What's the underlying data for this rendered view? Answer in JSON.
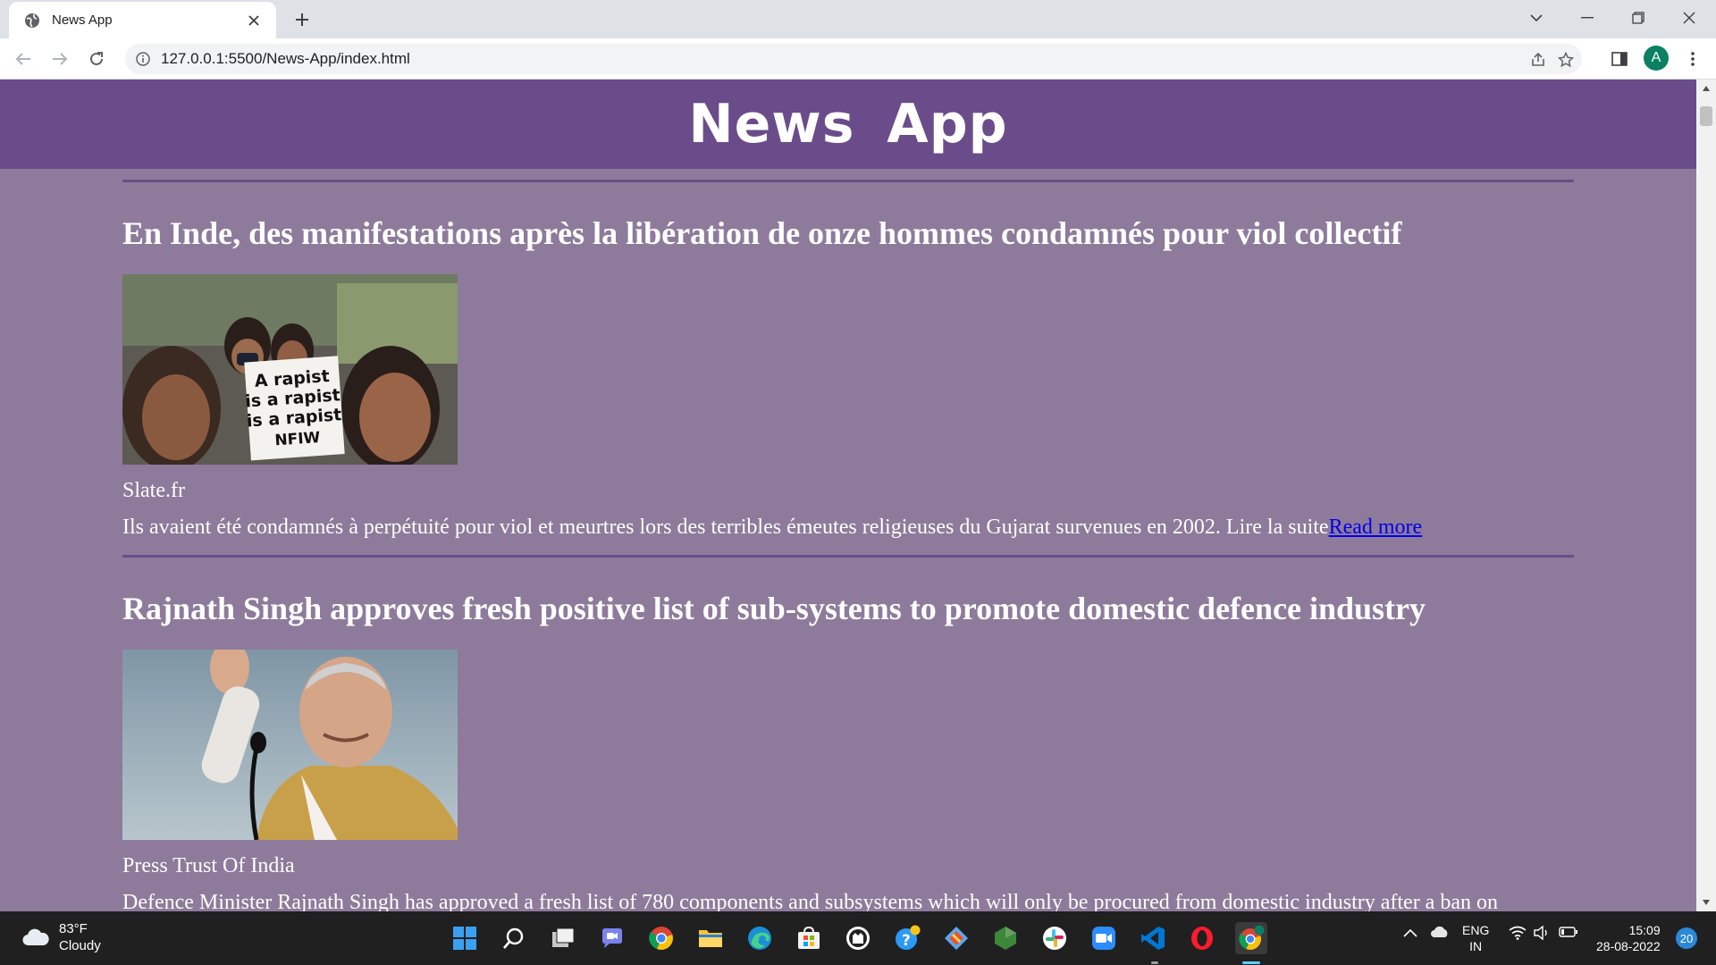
{
  "browser": {
    "tab_title": "News App",
    "url": "127.0.0.1:5500/News-App/index.html",
    "profile_initial": "A"
  },
  "page": {
    "title": "News App",
    "colors": {
      "header_bg": "#6b4c8a",
      "page_bg": "#8e7b9b",
      "divider": "#6b4c8a",
      "link": "#0000ee"
    },
    "articles": [
      {
        "title": "En Inde, des manifestations après la libération de onze hommes condamnés pour viol collectif",
        "image_alt": "protest-photo",
        "source": "Slate.fr",
        "description": "Ils avaient été condamnés à perpétuité pour viol et meurtres lors des terribles émeutes religieuses du Gujarat survenues en 2002. Lire la suite",
        "read_more": "Read more"
      },
      {
        "title": "Rajnath Singh approves fresh positive list of sub-systems to promote domestic defence industry",
        "image_alt": "speaker-photo",
        "source": "Press Trust Of India",
        "description": "Defence Minister Rajnath Singh has approved a fresh list of 780 components and subsystems which will only be procured from domestic industry after a ban on",
        "read_more": ""
      }
    ]
  },
  "taskbar": {
    "weather_temp": "83°F",
    "weather_desc": "Cloudy",
    "lang_line1": "ENG",
    "lang_line2": "IN",
    "time": "15:09",
    "date": "28-08-2022",
    "notification_count": "20",
    "apps": [
      "windows-start-icon",
      "search-icon",
      "task-view-icon",
      "teams-chat-icon",
      "chrome-icon",
      "file-explorer-icon",
      "edge-icon",
      "store-icon",
      "github-icon",
      "help-icon",
      "git-icon",
      "nodejs-icon",
      "slack-icon",
      "zoom-icon",
      "vscode-icon",
      "opera-icon",
      "chrome-profile-icon"
    ]
  }
}
